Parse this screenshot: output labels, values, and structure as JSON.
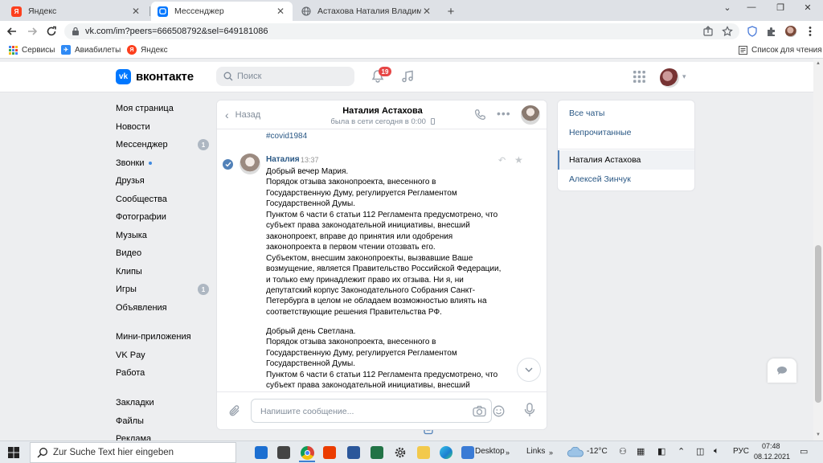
{
  "browser": {
    "tabs": [
      {
        "title": "Яндекс",
        "active": false
      },
      {
        "title": "Мессенджер",
        "active": true
      },
      {
        "title": "Астахова Наталия Владимиров",
        "active": false
      }
    ],
    "new_tab": "+",
    "url": "vk.com/im?peers=666508792&sel=649181086",
    "bookmarks": [
      {
        "label": "Сервисы"
      },
      {
        "label": "Авиабилеты"
      },
      {
        "label": "Яндекс"
      }
    ],
    "reading_list": "Список для чтения"
  },
  "vk": {
    "logo_letter": "vk",
    "brand": "вконтакте",
    "search_placeholder": "Поиск",
    "notifications_count": "19",
    "accent": "#0077ff",
    "menu": [
      {
        "label": "Моя страница",
        "icon": "user-circle-icon"
      },
      {
        "label": "Новости",
        "icon": "news-icon"
      },
      {
        "label": "Мессенджер",
        "icon": "message-icon",
        "count": "1"
      },
      {
        "label": "Звонки",
        "icon": "phone-icon",
        "dot": true
      },
      {
        "label": "Друзья",
        "icon": "friends-icon"
      },
      {
        "label": "Сообщества",
        "icon": "communities-icon"
      },
      {
        "label": "Фотографии",
        "icon": "photo-icon"
      },
      {
        "label": "Музыка",
        "icon": "music-icon"
      },
      {
        "label": "Видео",
        "icon": "video-icon"
      },
      {
        "label": "Клипы",
        "icon": "clips-icon"
      },
      {
        "label": "Игры",
        "icon": "games-icon",
        "count": "1"
      },
      {
        "label": "Объявления",
        "icon": "ads-icon"
      },
      {
        "label": "Мини-приложения",
        "icon": "apps-icon"
      },
      {
        "label": "VK Pay",
        "icon": "vkpay-icon"
      },
      {
        "label": "Работа",
        "icon": "work-icon"
      },
      {
        "label": "Закладки",
        "icon": "star-icon"
      },
      {
        "label": "Файлы",
        "icon": "files-icon"
      },
      {
        "label": "Реклама",
        "icon": "ad-icon"
      }
    ]
  },
  "chat": {
    "back_label": "Назад",
    "contact_name": "Наталия Астахова",
    "status": "была в сети сегодня в 0:00",
    "hashtag": "#covid1984",
    "message": {
      "author": "Наталия",
      "time": "13:37",
      "paragraph1": [
        "Добрый вечер Мария.",
        "Порядок отзыва законопроекта, внесенного в",
        "Государственную Думу, регулируется Регламентом",
        "Государственной Думы.",
        "Пунктом 6 части 6 статьи 112 Регламента предусмотрено, что",
        "субъект права законодательной инициативы, внесший",
        "законопроект, вправе до принятия или одобрения",
        "законопроекта в первом чтении отозвать его.",
        "Субъектом, внесшим законопроекты, вызвавшие Ваше",
        "возмущение, является Правительство Российской Федерации,",
        "и только ему принадлежит право их отзыва. Ни я, ни",
        "депутатский корпус Законодательного Собрания Санкт-",
        "Петербурга в целом не обладаем возможностью влиять на",
        "соответствующие решения Правительства РФ."
      ],
      "paragraph2": [
        "Добрый день Светлана.",
        "Порядок отзыва законопроекта, внесенного в",
        "Государственную Думу, регулируется Регламентом",
        "Государственной Думы.",
        "Пунктом 6 части 6 статьи 112 Регламента предусмотрено, что",
        "субъект права законодательной инициативы, внесший"
      ]
    },
    "composer_placeholder": "Напишите сообщение..."
  },
  "right_panel": {
    "filters": [
      "Все чаты",
      "Непрочитанные"
    ],
    "conversations": [
      {
        "name": "Наталия Астахова",
        "active": true
      },
      {
        "name": "Алексей Зинчук",
        "active": false
      }
    ]
  },
  "taskbar": {
    "search_placeholder": "Zur Suche Text hier eingeben",
    "toolbar_desktop": "Desktop",
    "toolbar_links": "Links",
    "temperature": "-12°C",
    "language": "РУС",
    "time": "07:48",
    "date": "08.12.2021"
  }
}
